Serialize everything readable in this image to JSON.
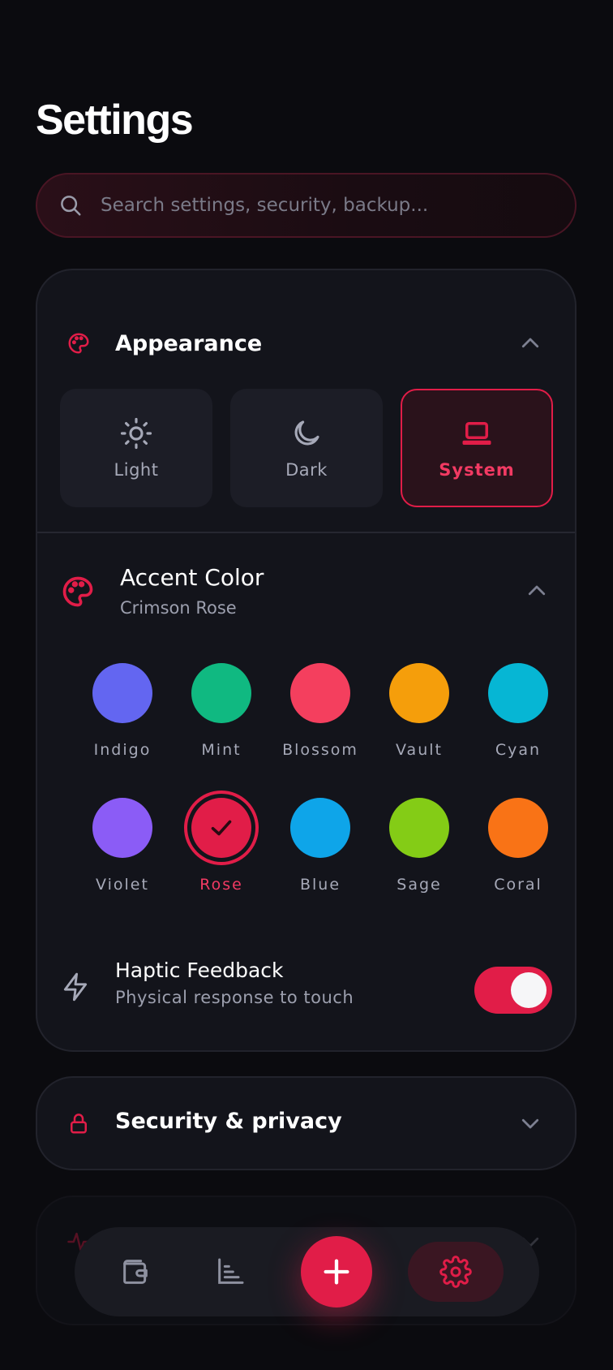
{
  "page": {
    "title": "Settings"
  },
  "search": {
    "placeholder": "Search settings, security, backup..."
  },
  "appearance": {
    "title": "Appearance",
    "modes": [
      {
        "label": "Light",
        "icon": "sun-icon"
      },
      {
        "label": "Dark",
        "icon": "moon-icon"
      },
      {
        "label": "System",
        "icon": "laptop-icon",
        "selected": true
      }
    ]
  },
  "accent": {
    "title": "Accent Color",
    "current": "Crimson Rose",
    "colors": [
      {
        "name": "Indigo",
        "hex": "#6366f1"
      },
      {
        "name": "Mint",
        "hex": "#10b981"
      },
      {
        "name": "Blossom",
        "hex": "#f43f5e"
      },
      {
        "name": "Vault",
        "hex": "#f59e0b"
      },
      {
        "name": "Cyan",
        "hex": "#06b6d4"
      },
      {
        "name": "Violet",
        "hex": "#8b5cf6"
      },
      {
        "name": "Rose",
        "hex": "#e11d48",
        "selected": true
      },
      {
        "name": "Blue",
        "hex": "#0ea5e9"
      },
      {
        "name": "Sage",
        "hex": "#84cc16"
      },
      {
        "name": "Coral",
        "hex": "#f97316"
      }
    ]
  },
  "haptic": {
    "title": "Haptic Feedback",
    "subtitle": "Physical response to touch",
    "enabled": true
  },
  "security": {
    "title": "Security & privacy"
  },
  "theme": {
    "accent": "#e11d48",
    "background": "#0b0b0f",
    "card": "#13141b"
  },
  "nav": {
    "items": [
      {
        "icon": "wallet-icon"
      },
      {
        "icon": "bar-chart-icon"
      },
      {
        "icon": "plus-icon"
      },
      {
        "icon": "gear-icon",
        "active": true
      }
    ]
  }
}
